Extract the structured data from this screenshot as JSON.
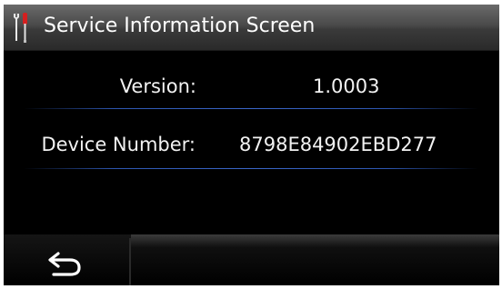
{
  "header": {
    "title": "Service Information Screen",
    "icon": "tools-icon"
  },
  "info": [
    {
      "label": "Version:",
      "value": "1.0003"
    },
    {
      "label": "Device Number:",
      "value": "8798E84902EBD277"
    }
  ],
  "footer": {
    "back_icon": "back-icon"
  },
  "colors": {
    "background": "#000000",
    "text": "#f2f2f2",
    "separator": "#3a66c8",
    "titlebar": "#4a4a4a",
    "icon_accent": "#d42020"
  }
}
